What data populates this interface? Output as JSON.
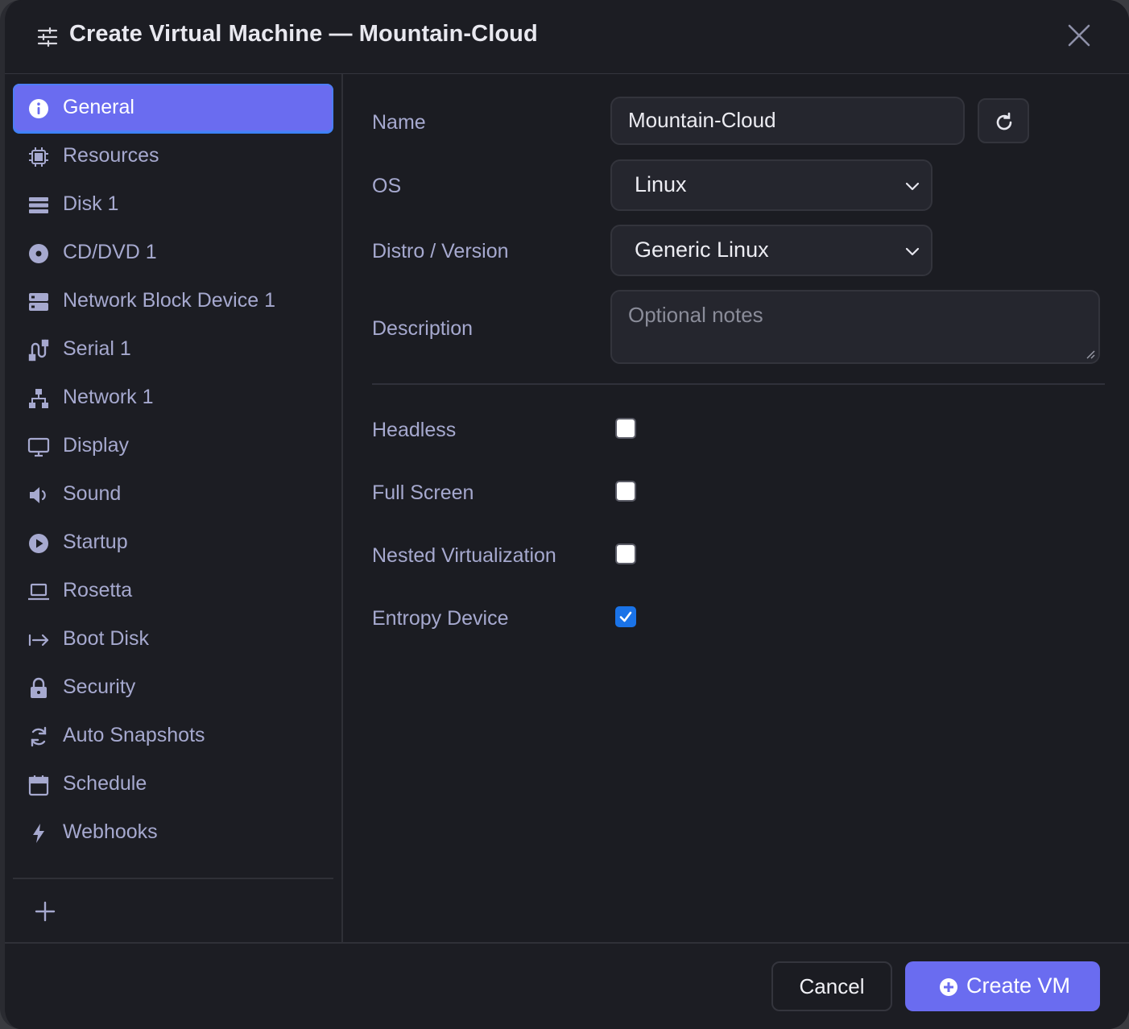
{
  "dialog": {
    "title": "Create Virtual Machine — Mountain-Cloud",
    "accent_color": "#6a6cf0"
  },
  "sidebar": {
    "items": [
      {
        "label": "General",
        "icon": "info-circle-icon",
        "active": true
      },
      {
        "label": "Resources",
        "icon": "cpu-chip-icon"
      },
      {
        "label": "Disk 1",
        "icon": "disk-stack-icon"
      },
      {
        "label": "CD/DVD 1",
        "icon": "cd-disc-icon"
      },
      {
        "label": "Network Block Device 1",
        "icon": "server-icon"
      },
      {
        "label": "Serial 1",
        "icon": "serial-plug-icon"
      },
      {
        "label": "Network 1",
        "icon": "network-tree-icon"
      },
      {
        "label": "Display",
        "icon": "monitor-icon"
      },
      {
        "label": "Sound",
        "icon": "speaker-icon"
      },
      {
        "label": "Startup",
        "icon": "play-circle-icon"
      },
      {
        "label": "Rosetta",
        "icon": "laptop-icon"
      },
      {
        "label": "Boot Disk",
        "icon": "arrow-right-bar-icon"
      },
      {
        "label": "Security",
        "icon": "lock-icon"
      },
      {
        "label": "Auto Snapshots",
        "icon": "refresh-arrows-icon"
      },
      {
        "label": "Schedule",
        "icon": "calendar-icon"
      },
      {
        "label": "Webhooks",
        "icon": "lightning-icon"
      }
    ],
    "add_icon": "plus-icon"
  },
  "form": {
    "name_label": "Name",
    "name_value": "Mountain-Cloud",
    "os_label": "OS",
    "os_value": "Linux",
    "distro_label": "Distro / Version",
    "distro_value": "Generic Linux",
    "description_label": "Description",
    "description_placeholder": "Optional notes",
    "headless_label": "Headless",
    "headless_checked": false,
    "fullscreen_label": "Full Screen",
    "fullscreen_checked": false,
    "nested_label": "Nested Virtualization",
    "nested_checked": false,
    "entropy_label": "Entropy Device",
    "entropy_checked": true
  },
  "footer": {
    "cancel_label": "Cancel",
    "create_label": "Create VM"
  }
}
